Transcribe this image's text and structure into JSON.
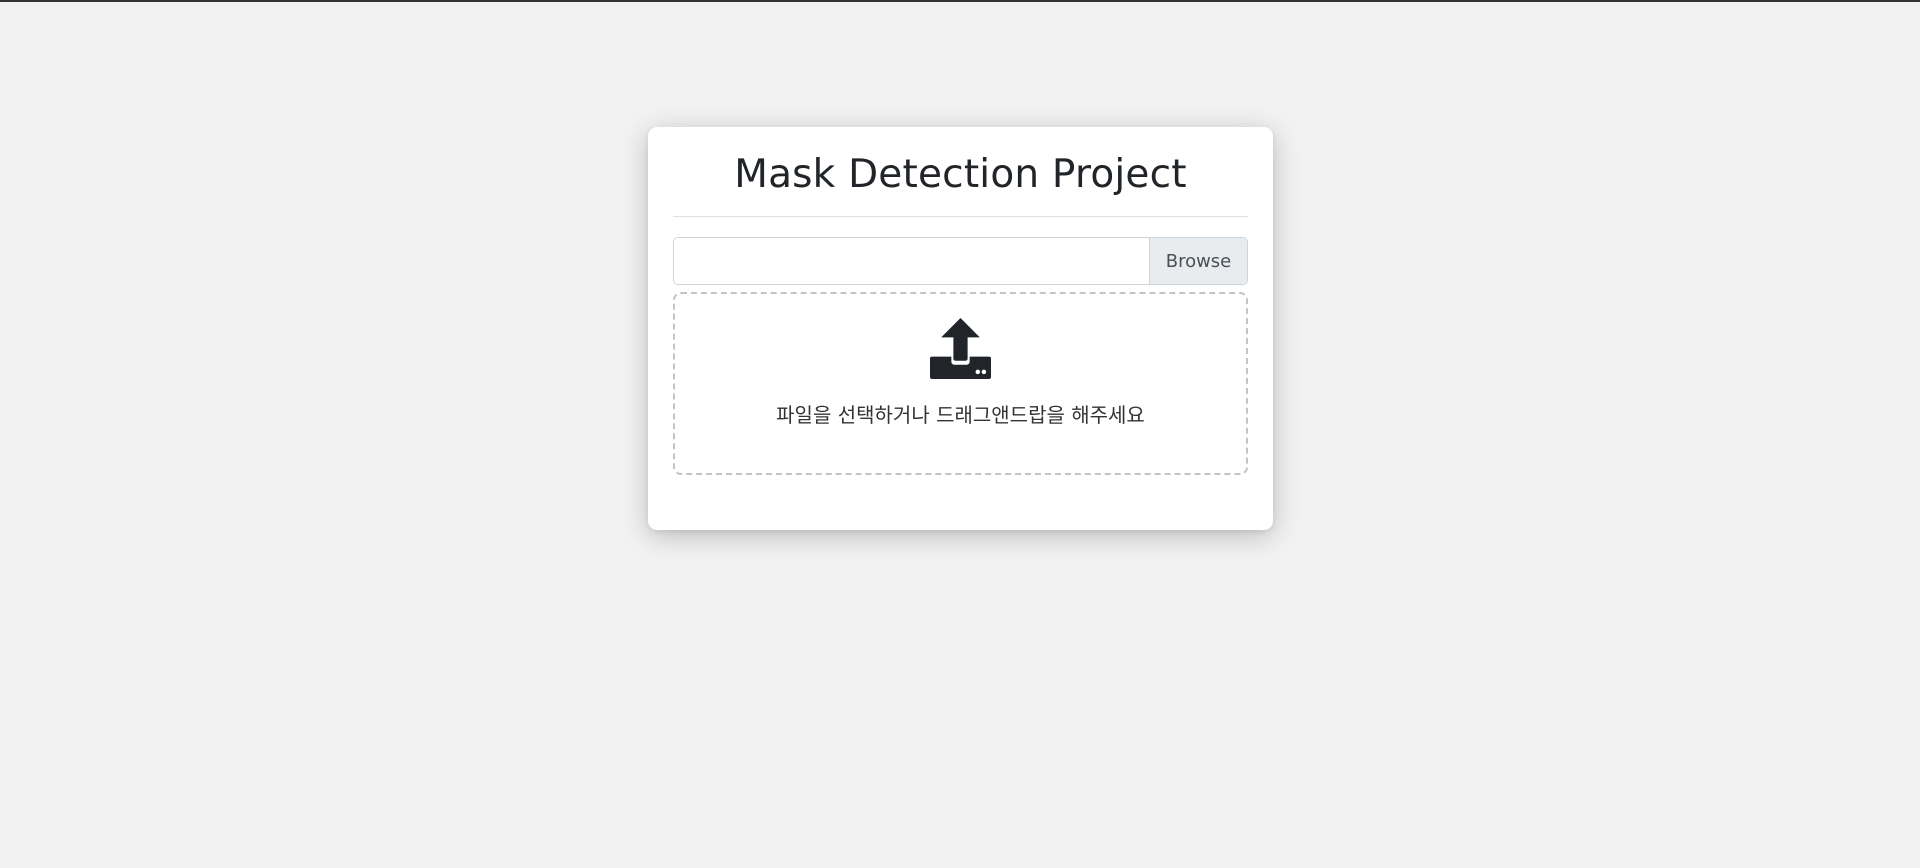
{
  "card": {
    "title": "Mask Detection Project"
  },
  "file_input": {
    "value": "",
    "browse_label": "Browse"
  },
  "dropzone": {
    "icon": "upload-icon",
    "text": "파일을 선택하거나 드래그앤드랍을 해주세요"
  },
  "colors": {
    "background": "#f2f2f2",
    "card": "#ffffff",
    "text": "#212529",
    "browse_bg": "#e9ecef",
    "dashed_border": "#c4c4c4"
  }
}
